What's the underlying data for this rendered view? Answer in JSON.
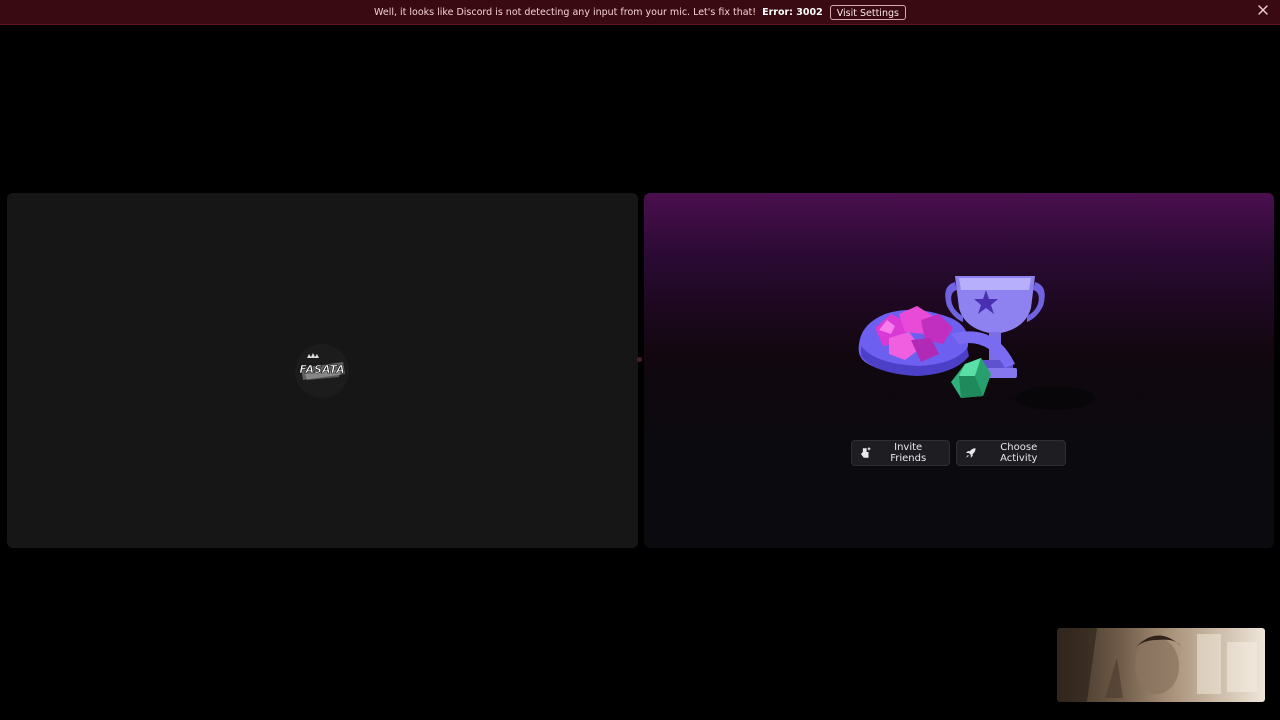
{
  "notice": {
    "message": "Well, it looks like Discord is not detecting any input from your mic. Let's fix that!",
    "error": "Error: 3002",
    "visit_settings_label": "Visit Settings",
    "close_icon": "close-icon"
  },
  "left_tile": {
    "avatar_icon": "user-avatar",
    "avatar_text": "FASATA"
  },
  "right_tile": {
    "illustration": "activities-illustration",
    "invite_label": "Invite Friends",
    "invite_icon": "add-friend-icon",
    "activity_label": "Choose Activity",
    "activity_icon": "rocket-icon"
  },
  "self_view": {
    "icon": "camera-preview"
  },
  "colors": {
    "notice_bg": "#3a0a12",
    "tile_bg": "#161616",
    "activity_gradient_top": "#4a0f4e",
    "button_bg": "#1e1e22"
  }
}
